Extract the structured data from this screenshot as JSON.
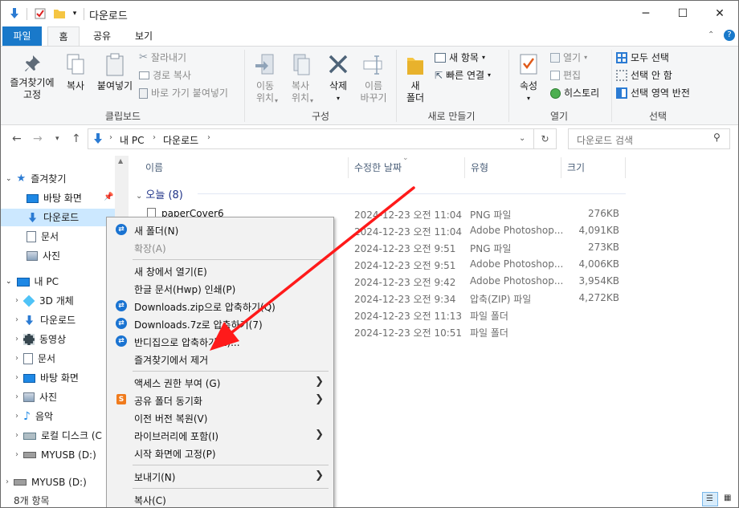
{
  "window": {
    "title": "다운로드",
    "minimize": "─",
    "maximize": "☐",
    "close": "✕"
  },
  "ribbon_tabs": [
    {
      "label": "파일"
    },
    {
      "label": "홈"
    },
    {
      "label": "공유"
    },
    {
      "label": "보기"
    }
  ],
  "ribbon": {
    "clipboard": {
      "pin": "즐겨찾기에\n고정",
      "copy": "복사",
      "paste": "붙여넣기",
      "cut": "잘라내기",
      "copy_path": "경로 복사",
      "paste_shortcut": "바로 가기 붙여넣기",
      "group": "클립보드"
    },
    "organize": {
      "move_to": "이동\n위치",
      "copy_to": "복사\n위치",
      "delete": "삭제",
      "rename": "이름\n바꾸기",
      "group": "구성"
    },
    "new": {
      "new_folder": "새\n폴더",
      "new_item": "새 항목",
      "easy_access": "빠른 연결",
      "group": "새로 만들기"
    },
    "open": {
      "properties": "속성",
      "open": "열기",
      "edit": "편집",
      "history": "히스토리",
      "group": "열기"
    },
    "select": {
      "select_all": "모두 선택",
      "select_none": "선택 안 함",
      "invert": "선택 영역 반전",
      "group": "선택"
    }
  },
  "address": {
    "crumbs": [
      "내 PC",
      "다운로드"
    ],
    "search_placeholder": "다운로드 검색"
  },
  "nav": {
    "quick_access": "즐겨찾기",
    "quick_items": [
      "바탕 화면",
      "다운로드",
      "문서",
      "사진"
    ],
    "this_pc": "내 PC",
    "pc_items": [
      "3D 개체",
      "다운로드",
      "동영상",
      "문서",
      "바탕 화면",
      "사진",
      "음악",
      "로컬 디스크 (C",
      "MYUSB (D:)"
    ],
    "usb": "MYUSB (D:)"
  },
  "columns": {
    "name": "이름",
    "modified": "수정한 날짜",
    "type": "유형",
    "size": "크기"
  },
  "group_header": "오늘 (8)",
  "files": [
    {
      "name": "paperCover6",
      "date": "2024-12-23 오전 11:04",
      "type": "PNG 파일",
      "size": "276KB"
    },
    {
      "name": "",
      "date": "2024-12-23 오전 11:04",
      "type": "Adobe Photoshop...",
      "size": "4,091KB"
    },
    {
      "name": "",
      "date": "2024-12-23 오전 9:51",
      "type": "PNG 파일",
      "size": "273KB"
    },
    {
      "name": "",
      "date": "2024-12-23 오전 9:51",
      "type": "Adobe Photoshop...",
      "size": "4,006KB"
    },
    {
      "name": "",
      "date": "2024-12-23 오전 9:42",
      "type": "Adobe Photoshop...",
      "size": "3,954KB"
    },
    {
      "name": "",
      "date": "2024-12-23 오전 9:34",
      "type": "압축(ZIP) 파일",
      "size": "4,272KB"
    },
    {
      "name": "",
      "date": "2024-12-23 오전 11:13",
      "type": "파일 폴더",
      "size": ""
    },
    {
      "name": "",
      "date": "2024-12-23 오전 10:51",
      "type": "파일 폴더",
      "size": ""
    }
  ],
  "status": {
    "count": "8개 항목"
  },
  "context_menu": {
    "items": [
      {
        "label": "새 폴더(N)"
      },
      {
        "label": "확장(A)"
      },
      {
        "label": "새 창에서 열기(E)"
      },
      {
        "label": "한글 문서(Hwp) 인쇄(P)"
      },
      {
        "label": "Downloads.zip으로 압축하기(Q)"
      },
      {
        "label": "Downloads.7z로 압축하기(7)"
      },
      {
        "label": "반디집으로 압축하기(E)..."
      },
      {
        "label": "즐겨찾기에서 제거"
      },
      {
        "label": "액세스 권한 부여 (G)"
      },
      {
        "label": "공유 폴더 동기화"
      },
      {
        "label": "이전 버전 복원(V)"
      },
      {
        "label": "라이브러리에 포함(I)"
      },
      {
        "label": "시작 화면에 고정(P)"
      },
      {
        "label": "보내기(N)"
      },
      {
        "label": "복사(C)"
      }
    ],
    "submenu_arrow": "❯"
  },
  "annotation": {
    "color": "#ff1a1a"
  }
}
